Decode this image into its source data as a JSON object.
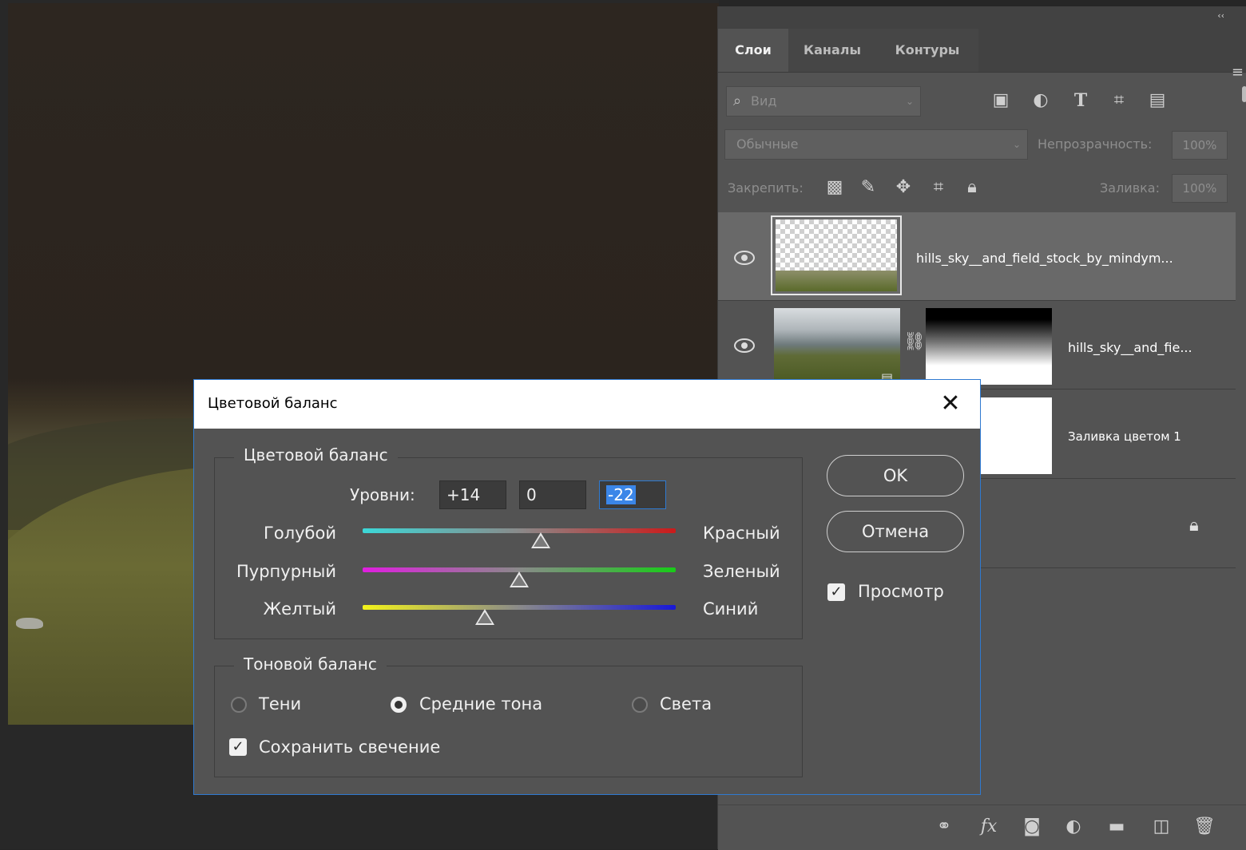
{
  "dialog": {
    "title": "Цветовой баланс",
    "close_glyph": "✕",
    "color_group_title": "Цветовой баланс",
    "levels_label": "Уровни:",
    "levels": [
      "+14",
      "0",
      "-22"
    ],
    "sliders": [
      {
        "left": "Голубой",
        "right": "Красный",
        "value": 14,
        "min": -100,
        "max": 100
      },
      {
        "left": "Пурпурный",
        "right": "Зеленый",
        "value": 0,
        "min": -100,
        "max": 100
      },
      {
        "left": "Желтый",
        "right": "Синий",
        "value": -22,
        "min": -100,
        "max": 100
      }
    ],
    "tone_group_title": "Тоновой баланс",
    "tone_options": [
      "Тени",
      "Средние тона",
      "Света"
    ],
    "tone_selected": "Средние тона",
    "preserve_luminosity_label": "Сохранить свечение",
    "preserve_luminosity_checked": true,
    "ok_label": "OK",
    "cancel_label": "Отмена",
    "preview_label": "Просмотр",
    "preview_checked": true
  },
  "layers_panel": {
    "collapse_glyph": "‹‹",
    "tabs": [
      {
        "label": "Слои",
        "active": true
      },
      {
        "label": "Каналы",
        "active": false
      },
      {
        "label": "Контуры",
        "active": false
      }
    ],
    "menu_glyph": "≡",
    "filter_placeholder": "Вид",
    "filter_icons": [
      "image-filter-icon",
      "adjustment-filter-icon",
      "type-filter-icon",
      "shape-filter-icon",
      "smart-object-filter-icon"
    ],
    "blend_mode": "Обычные",
    "opacity_label": "Непрозрачность:",
    "opacity_value": "100%",
    "lock_label": "Закрепить:",
    "lock_icons": [
      "lock-transparent-icon",
      "lock-image-icon",
      "lock-position-icon",
      "lock-artboard-icon",
      "lock-all-icon"
    ],
    "fill_label": "Заливка:",
    "fill_value": "100%",
    "layers": [
      {
        "name": "hills_sky__and_field_stock_by_mindym...",
        "visible": true,
        "selected": true
      },
      {
        "name": "hills_sky__and_fie...",
        "visible": true,
        "selected": false
      },
      {
        "name": "Заливка цветом 1",
        "visible": false,
        "selected": false
      },
      {
        "name": "",
        "visible": false,
        "selected": false,
        "locked": true
      }
    ],
    "footer_icons": [
      "link-layers-icon",
      "fx-icon",
      "add-mask-icon",
      "new-adjustment-layer-icon",
      "new-group-icon",
      "new-layer-icon",
      "delete-layer-icon"
    ]
  }
}
